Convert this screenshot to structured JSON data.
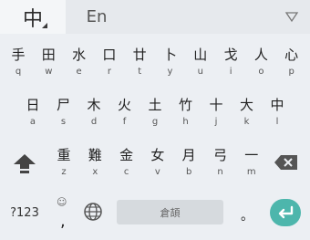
{
  "topbar": {
    "lang_zh": "中",
    "lang_en": "En",
    "collapse_icon": "triangle-down-icon"
  },
  "rows": [
    {
      "keys": [
        {
          "main": "手",
          "sub": "q"
        },
        {
          "main": "田",
          "sub": "w"
        },
        {
          "main": "水",
          "sub": "e"
        },
        {
          "main": "口",
          "sub": "r"
        },
        {
          "main": "廿",
          "sub": "t"
        },
        {
          "main": "卜",
          "sub": "y"
        },
        {
          "main": "山",
          "sub": "u"
        },
        {
          "main": "戈",
          "sub": "i"
        },
        {
          "main": "人",
          "sub": "o"
        },
        {
          "main": "心",
          "sub": "p"
        }
      ]
    },
    {
      "keys": [
        {
          "main": "日",
          "sub": "a"
        },
        {
          "main": "尸",
          "sub": "s"
        },
        {
          "main": "木",
          "sub": "d"
        },
        {
          "main": "火",
          "sub": "f"
        },
        {
          "main": "土",
          "sub": "g"
        },
        {
          "main": "竹",
          "sub": "h"
        },
        {
          "main": "十",
          "sub": "j"
        },
        {
          "main": "大",
          "sub": "k"
        },
        {
          "main": "中",
          "sub": "l"
        }
      ]
    },
    {
      "keys": [
        {
          "main": "重",
          "sub": "z"
        },
        {
          "main": "難",
          "sub": "x"
        },
        {
          "main": "金",
          "sub": "c"
        },
        {
          "main": "女",
          "sub": "v"
        },
        {
          "main": "月",
          "sub": "b"
        },
        {
          "main": "弓",
          "sub": "n"
        },
        {
          "main": "一",
          "sub": "m"
        }
      ]
    }
  ],
  "bottom": {
    "sym_label": "?123",
    "comma_label": ",",
    "emoji_hint": "☺",
    "space_label": "倉頡",
    "period_label": "。"
  },
  "colors": {
    "background": "#eceff3",
    "enter_accent": "#4db6ac",
    "space_bg": "#d6dade"
  }
}
